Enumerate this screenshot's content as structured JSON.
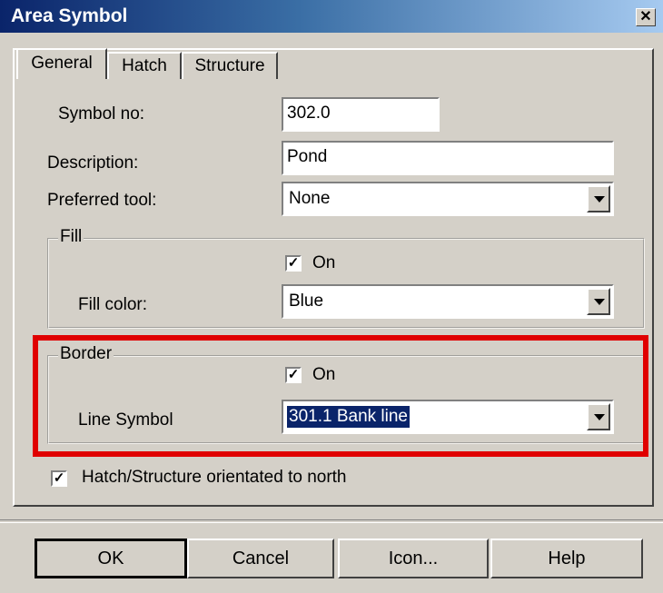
{
  "window": {
    "title": "Area Symbol",
    "close_glyph": "✕"
  },
  "tabs": [
    {
      "label": "General",
      "active": true
    },
    {
      "label": "Hatch",
      "active": false
    },
    {
      "label": "Structure",
      "active": false
    }
  ],
  "general": {
    "symbol_no_label": "Symbol no:",
    "symbol_no_value": "302.0",
    "description_label": "Description:",
    "description_value": "Pond",
    "preferred_tool_label": "Preferred tool:",
    "preferred_tool_value": "None"
  },
  "fill": {
    "group_title": "Fill",
    "on_label": "On",
    "on_checked": true,
    "color_label": "Fill color:",
    "color_value": "Blue"
  },
  "border": {
    "group_title": "Border",
    "on_label": "On",
    "on_checked": true,
    "line_symbol_label": "Line Symbol",
    "line_symbol_value": "301.1 Bank line"
  },
  "hatch_orientation": {
    "label": "Hatch/Structure orientated to north",
    "checked": true
  },
  "buttons": {
    "ok": "OK",
    "cancel": "Cancel",
    "icon": "Icon...",
    "help": "Help"
  },
  "check_glyph": "✓",
  "colors": {
    "title_start": "#0a246a",
    "title_end": "#a6caf0",
    "face": "#d4d0c8",
    "highlight_box": "#e00000",
    "selection": "#0a246a"
  }
}
